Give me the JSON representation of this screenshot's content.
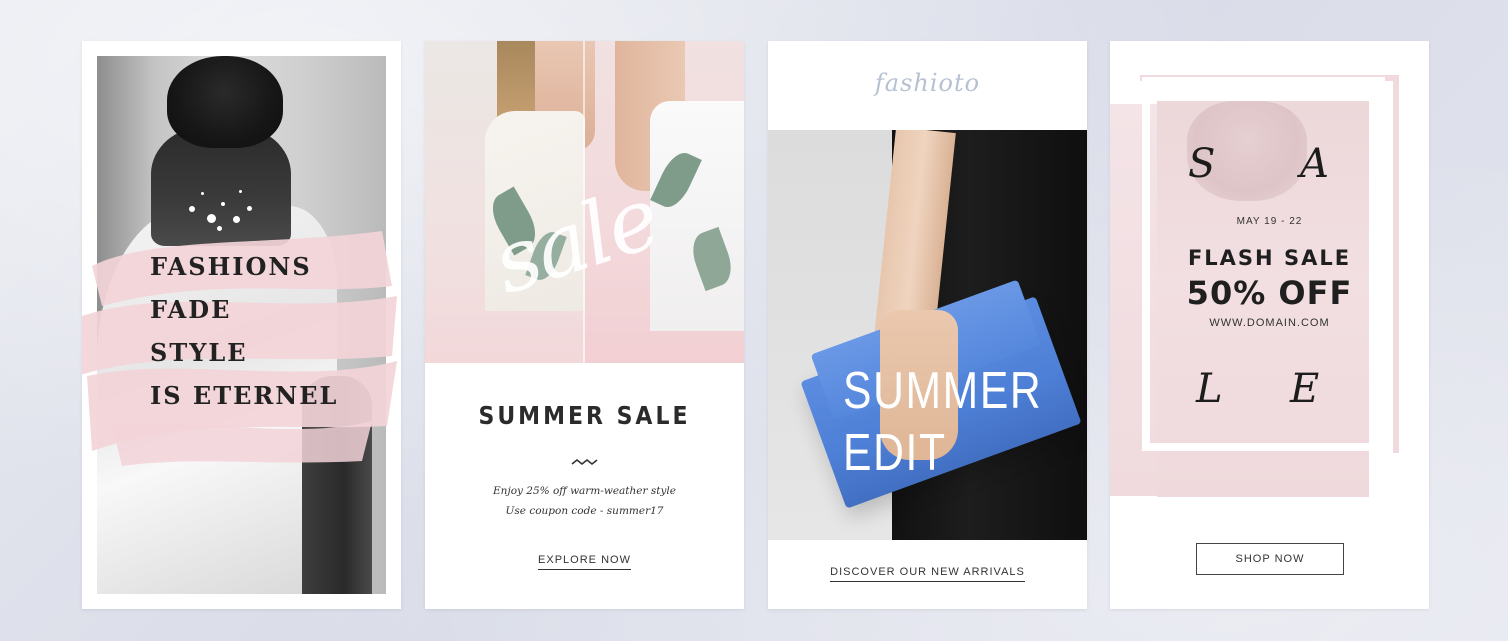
{
  "cards": [
    {
      "quote_lines": [
        "FASHIONS",
        "FADE",
        "STYLE",
        "IS ETERNEL"
      ]
    },
    {
      "script_word": "sale",
      "title": "SUMMER SALE",
      "body_lines": [
        "Enjoy 25% off warm-weather style",
        "Use coupon code - summer17"
      ],
      "cta": "EXPLORE NOW"
    },
    {
      "logo": "fashioto",
      "title_lines": [
        "SUMMER",
        "EDIT"
      ],
      "cta": "DISCOVER OUR NEW ARRIVALS"
    },
    {
      "letters": [
        "S",
        "A",
        "L",
        "E"
      ],
      "date": "MAY 19 - 22",
      "headline": "FLASH SALE",
      "offer": "50% OFF",
      "website": "WWW.DOMAIN.COM",
      "cta": "SHOP NOW"
    }
  ],
  "colors": {
    "background": "#e1e3ec",
    "blush_pink": "#f2d4d8",
    "clutch_blue": "#4d7fd6",
    "logo_blue_gray": "#b7c1d3",
    "ink": "#222222"
  }
}
